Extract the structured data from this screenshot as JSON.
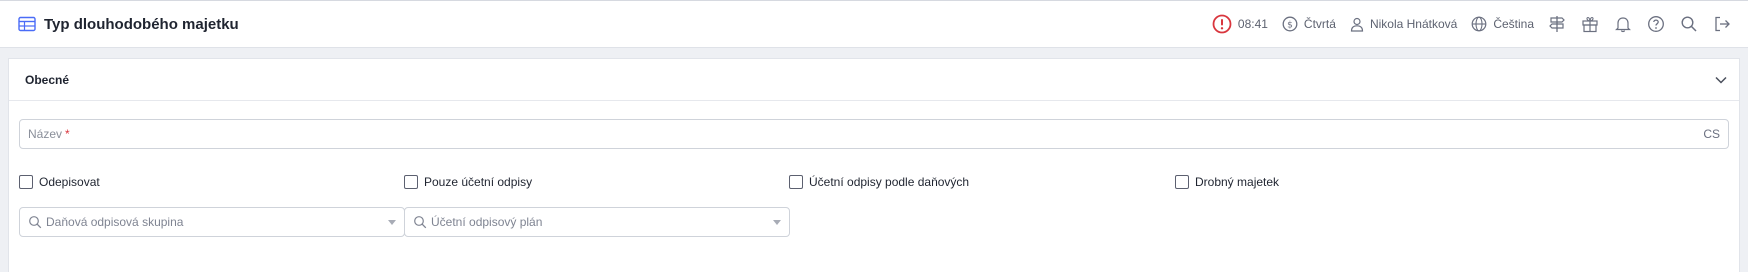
{
  "header": {
    "title": "Typ dlouhodobého majetku",
    "time": "08:41",
    "currency_label": "Čtvrtá",
    "user_name": "Nikola Hnátková",
    "language": "Čeština",
    "alert_color": "#d9363e",
    "toolbar_icons": [
      "signpost-icon",
      "gift-icon",
      "bell-icon",
      "help-icon",
      "search-icon",
      "logout-icon"
    ]
  },
  "section": {
    "title": "Obecné",
    "expanded": true
  },
  "form": {
    "name_field": {
      "label": "Název",
      "required_mark": "*",
      "language_code": "CS",
      "value": ""
    },
    "checkboxes": [
      {
        "label": "Odepisovat",
        "checked": false
      },
      {
        "label": "Pouze účetní odpisy",
        "checked": false
      },
      {
        "label": "Účetní odpisy podle daňových",
        "checked": false
      },
      {
        "label": "Drobný majetek",
        "checked": false
      }
    ],
    "selects": [
      {
        "placeholder": "Daňová odpisová skupina",
        "value": ""
      },
      {
        "placeholder": "Účetní odpisový plán",
        "value": ""
      }
    ]
  }
}
